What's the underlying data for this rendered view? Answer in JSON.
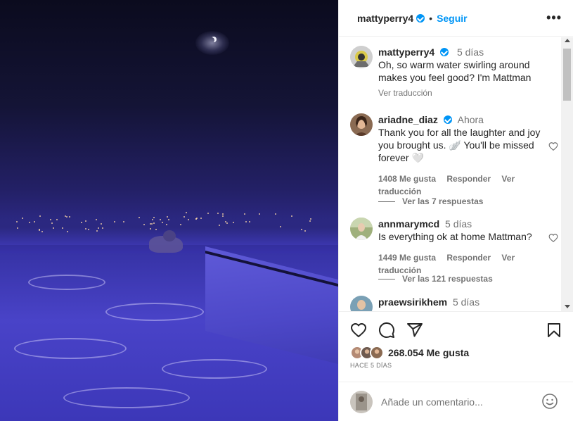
{
  "post": {
    "author": "mattyperry4",
    "follow_label": "Seguir",
    "separator": "•",
    "more_label": "•••"
  },
  "comments": [
    {
      "user": "mattyperry4",
      "time": "5 días",
      "text": "Oh, so warm water swirling around makes you feel good? I'm Mattman",
      "translate": "Ver traducción"
    },
    {
      "user": "ariadne_diaz",
      "time": "Ahora",
      "text": "Thank you for all the laughter and joy you brought us. 🪽 You'll be missed forever 🤍",
      "likes": "1408 Me gusta",
      "reply": "Responder",
      "translate": "Ver traducción",
      "replies": "Ver las 7 respuestas"
    },
    {
      "user": "annmarymcd",
      "time": "5 días",
      "text": "Is everything ok at home Mattman?",
      "likes": "1449 Me gusta",
      "reply": "Responder",
      "translate": "Ver traducción",
      "replies": "Ver las 121 respuestas"
    },
    {
      "user": "praewsirikhem",
      "time": "5 días"
    }
  ],
  "actions": {
    "like_icon": "heart-icon",
    "comment_icon": "comment-bubble-icon",
    "share_icon": "paper-plane-icon",
    "save_icon": "bookmark-icon"
  },
  "likes_summary": "268.054 Me gusta",
  "time_ago": "HACE 5 DÍAS",
  "add_comment": {
    "placeholder": "Añade un comentario..."
  },
  "colors": {
    "accent": "#0095f6",
    "text": "#262626",
    "muted": "#737373",
    "photo_blue": "#3a34b4"
  }
}
